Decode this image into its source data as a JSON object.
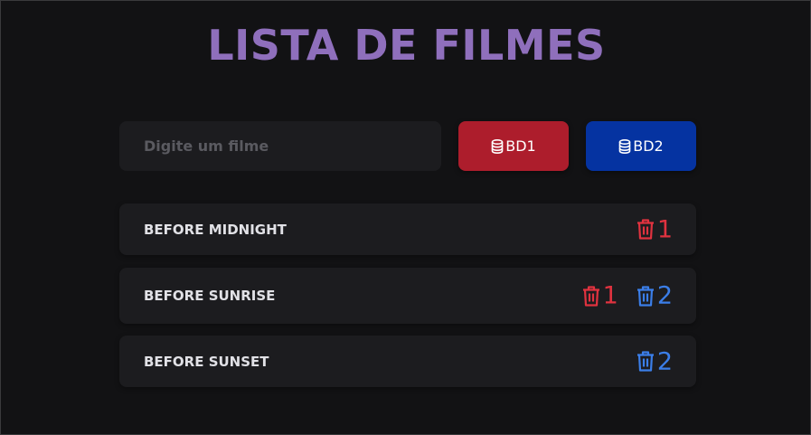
{
  "header": {
    "title": "LISTA DE FILMES"
  },
  "form": {
    "placeholder": "Digite um filme",
    "bd1_label": "BD1",
    "bd2_label": "BD2"
  },
  "icons": {
    "database": "database-icon",
    "delete": "trash-icon"
  },
  "colors": {
    "title": "#8f6fbc",
    "bd1": "#ad1d2c",
    "bd2": "#0533a1",
    "delete_bd1": "#e0323f",
    "delete_bd2": "#3b7ee8"
  },
  "movies": [
    {
      "title": "BEFORE MIDNIGHT",
      "bd1": "1",
      "bd2": ""
    },
    {
      "title": "BEFORE SUNRISE",
      "bd1": "1",
      "bd2": "2"
    },
    {
      "title": "BEFORE SUNSET",
      "bd1": "",
      "bd2": "2"
    }
  ]
}
